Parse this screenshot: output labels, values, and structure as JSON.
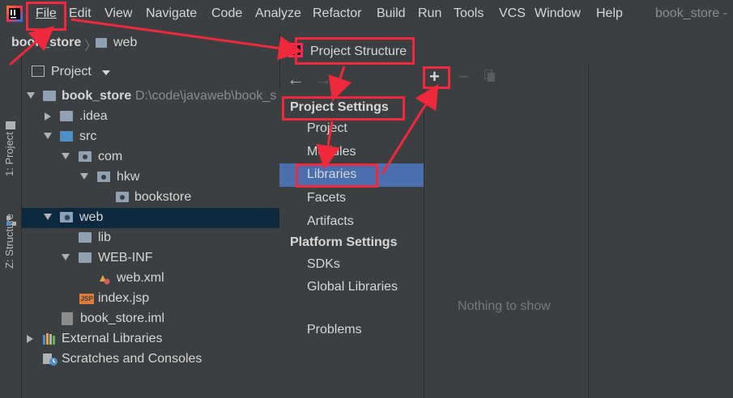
{
  "menu": {
    "items": [
      "File",
      "Edit",
      "View",
      "Navigate",
      "Code",
      "Analyze",
      "Refactor",
      "Build",
      "Run",
      "Tools",
      "VCS",
      "Window",
      "Help"
    ],
    "window_title": "book_store -"
  },
  "breadcrumb": {
    "project": "book_store",
    "folder": "web"
  },
  "toolstrip": {
    "project_tab": "1: Project",
    "structure_tab": "Z: Structure"
  },
  "project_panel": {
    "title": "Project",
    "root_name": "book_store",
    "root_path": "D:\\code\\javaweb\\book_s",
    "nodes": {
      "idea": ".idea",
      "src": "src",
      "com": "com",
      "hkw": "hkw",
      "bookstore": "bookstore",
      "web": "web",
      "lib": "lib",
      "webinf": "WEB-INF",
      "webxml": "web.xml",
      "indexjsp": "index.jsp",
      "iml": "book_store.iml",
      "external": "External Libraries",
      "scratches": "Scratches and Consoles"
    },
    "jsp_badge": "JSP"
  },
  "dialog": {
    "title": "Project Structure",
    "nav": {
      "back": "←",
      "forward": "→"
    },
    "project_settings_heading": "Project Settings",
    "project_settings": [
      "Project",
      "Modules",
      "Libraries",
      "Facets",
      "Artifacts"
    ],
    "platform_settings_heading": "Platform Settings",
    "platform_settings": [
      "SDKs",
      "Global Libraries"
    ],
    "problems": "Problems",
    "toolbar": {
      "add": "+",
      "remove": "−"
    },
    "empty_text": "Nothing to show",
    "selected_item": "Libraries"
  },
  "colors": {
    "annotation_red": "#f0283c",
    "selection_blue": "#4b6eaf"
  }
}
